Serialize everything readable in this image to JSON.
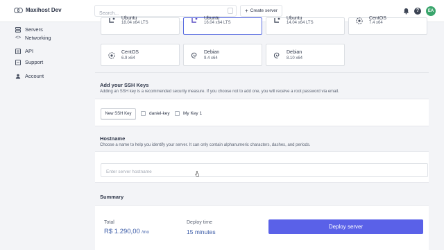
{
  "app": {
    "title": "Maxihost Dev"
  },
  "header": {
    "search_placeholder": "Search...",
    "create_label": "Create server",
    "avatar_initials": "EA"
  },
  "sidebar": {
    "items": [
      {
        "label": "Servers",
        "icon": "servers-icon"
      },
      {
        "label": "Networking",
        "icon": "networking-icon"
      },
      {
        "label": "API",
        "icon": "api-icon"
      },
      {
        "label": "Support",
        "icon": "support-icon"
      },
      {
        "label": "Account",
        "icon": "account-icon"
      }
    ]
  },
  "os_options": [
    {
      "name": "Ubuntu",
      "version": "18.04 x64 LTS",
      "icon": "ubuntu-icon"
    },
    {
      "name": "Ubuntu",
      "version": "16.04 x64 LTS",
      "icon": "ubuntu-icon",
      "selected": true
    },
    {
      "name": "Ubuntu",
      "version": "14.04 x64 LTS",
      "icon": "ubuntu-icon"
    },
    {
      "name": "CentOS",
      "version": "7.4 x64",
      "icon": "centos-icon"
    },
    {
      "name": "CentOS",
      "version": "6.9 x64",
      "icon": "centos-icon"
    },
    {
      "name": "Debian",
      "version": "9.4 x64",
      "icon": "debian-icon"
    },
    {
      "name": "Debian",
      "version": "8.10 x64",
      "icon": "debian-icon"
    }
  ],
  "ssh": {
    "title": "Add your SSH Keys",
    "description": "Adding an SSH key is a recommended security measure. If you choose not to add one, you will receive a root password via email.",
    "new_key_label": "New SSH Key",
    "keys": [
      "daniel-key",
      "My Key 1"
    ]
  },
  "hostname": {
    "title": "Hostname",
    "description": "Choose a name to help you identify your server. It can only contain alphanumeric characters, dashes, and periods.",
    "placeholder": "Enter server hostname"
  },
  "summary": {
    "title": "Summary",
    "total_label": "Total",
    "total_value": "R$ 1.290,00",
    "total_unit": "/mo",
    "deploy_time_label": "Deploy time",
    "deploy_time_value": "15 minutes",
    "deploy_button": "Deploy server"
  },
  "colors": {
    "accent": "#5a61e8",
    "selected_border": "#5b6ee1",
    "price": "#3a5aa6",
    "avatar": "#3aa56c"
  }
}
